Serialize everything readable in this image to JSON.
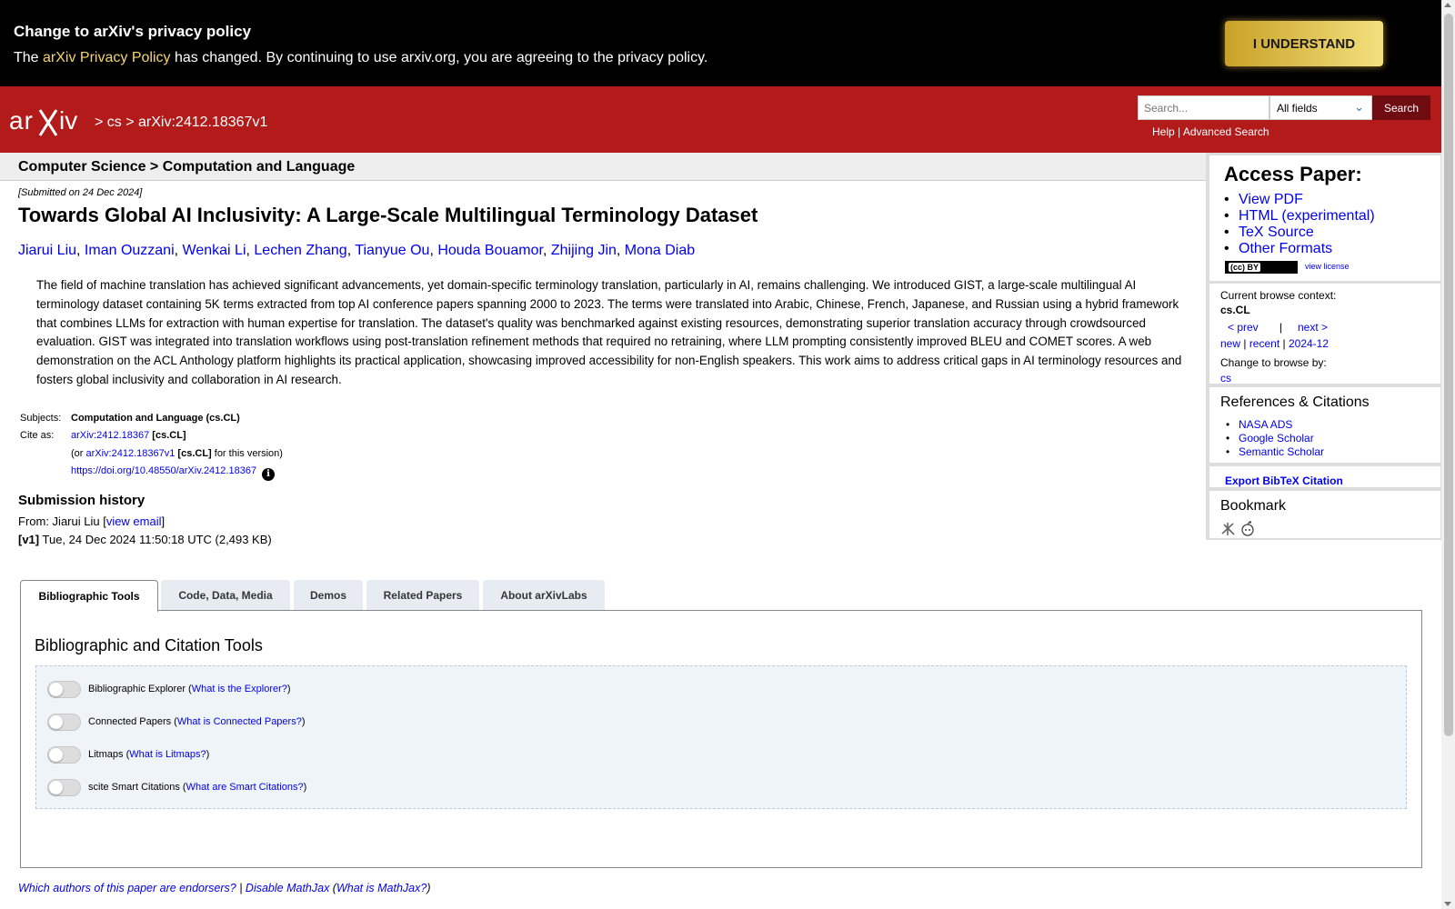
{
  "privacy": {
    "title": "Change to arXiv's privacy policy",
    "text_before": "The ",
    "policy_link": "arXiv Privacy Policy",
    "text_after": " has changed. By continuing to use arxiv.org, you are agreeing to the privacy policy.",
    "button": "I UNDERSTAND"
  },
  "header": {
    "logo": "arXiv",
    "breadcrumb_sep1": " > ",
    "breadcrumb_cat": "cs",
    "breadcrumb_sep2": " > ",
    "breadcrumb_id": "arXiv:2412.18367v1",
    "search_placeholder": "Search...",
    "search_field": "All fields",
    "search_button": "Search",
    "help": "Help",
    "sep": " | ",
    "advanced": "Advanced Search"
  },
  "category_bar": "Computer Science > Computation and Language",
  "paper": {
    "submitted": "[Submitted on 24 Dec 2024]",
    "title": "Towards Global AI Inclusivity: A Large-Scale Multilingual Terminology Dataset",
    "authors": [
      "Jiarui Liu",
      "Iman Ouzzani",
      "Wenkai Li",
      "Lechen Zhang",
      "Tianyue Ou",
      "Houda Bouamor",
      "Zhijing Jin",
      "Mona Diab"
    ],
    "abstract": "The field of machine translation has achieved significant advancements, yet domain-specific terminology translation, particularly in AI, remains challenging. We introduced GIST, a large-scale multilingual AI terminology dataset containing 5K terms extracted from top AI conference papers spanning 2000 to 2023. The terms were translated into Arabic, Chinese, French, Japanese, and Russian using a hybrid framework that combines LLMs for extraction with human expertise for translation. The dataset's quality was benchmarked against existing resources, demonstrating superior translation accuracy through crowdsourced evaluation. GIST was integrated into translation workflows using post-translation refinement methods that required no retraining, where LLM prompting consistently improved BLEU and COMET scores. A web demonstration on the ACL Anthology platform highlights its practical application, showcasing improved accessibility for non-English speakers. This work aims to address critical gaps in AI terminology resources and fosters global inclusivity and collaboration in AI research."
  },
  "meta": {
    "subjects_label": "Subjects:",
    "subjects_value": "Computation and Language (cs.CL)",
    "cite_label": "Cite as:",
    "cite_id": "arXiv:2412.18367",
    "cite_cat": " [cs.CL]",
    "or_prefix": "(or ",
    "version_id": "arXiv:2412.18367v1",
    "version_cat": " [cs.CL]",
    "version_suffix": " for this version)",
    "doi": "https://doi.org/10.48550/arXiv.2412.18367",
    "info_icon": "i"
  },
  "history": {
    "heading": "Submission history",
    "from_prefix": "From: Jiarui Liu [",
    "view_email": "view email",
    "from_suffix": "]",
    "v1_label": "[v1]",
    "v1_text": " Tue, 24 Dec 2024 11:50:18 UTC (2,493 KB)"
  },
  "sidebar": {
    "access_title": "Access Paper:",
    "access_links": [
      "View PDF",
      "HTML (experimental)",
      "TeX Source",
      "Other Formats"
    ],
    "cc_badge": "(cc) BY",
    "view_license": "view license",
    "browse_context_label": "Current browse context:",
    "browse_context": "cs.CL",
    "prev": "< prev",
    "pipe": "|",
    "next": "next >",
    "new": "new",
    "recent": "recent",
    "month": "2024-12",
    "change_browse": "Change to browse by:",
    "browse_cs": "cs",
    "refs_title": "References & Citations",
    "refs": [
      "NASA ADS",
      "Google Scholar",
      "Semantic Scholar"
    ],
    "bibtex": "Export BibTeX Citation",
    "bookmark": "Bookmark"
  },
  "tabs": [
    "Bibliographic Tools",
    "Code, Data, Media",
    "Demos",
    "Related Papers",
    "About arXivLabs"
  ],
  "tools": {
    "heading": "Bibliographic and Citation Tools",
    "items": [
      {
        "name": "Bibliographic Explorer",
        "link": "What is the Explorer?"
      },
      {
        "name": "Connected Papers",
        "link": "What is Connected Papers?"
      },
      {
        "name": "Litmaps",
        "link": "What is Litmaps?"
      },
      {
        "name": "scite Smart Citations",
        "link": "What are Smart Citations?"
      }
    ]
  },
  "footer": {
    "endorsers": "Which authors of this paper are endorsers?",
    "sep": " | ",
    "disable": "Disable MathJax",
    "open": " (",
    "what": "What is MathJax?",
    "close": ")"
  },
  "colors": {
    "header_red": "#b31b1b",
    "banner_black": "#000000",
    "button_gold": "#c9a227",
    "link_blue": "#0000ee"
  }
}
